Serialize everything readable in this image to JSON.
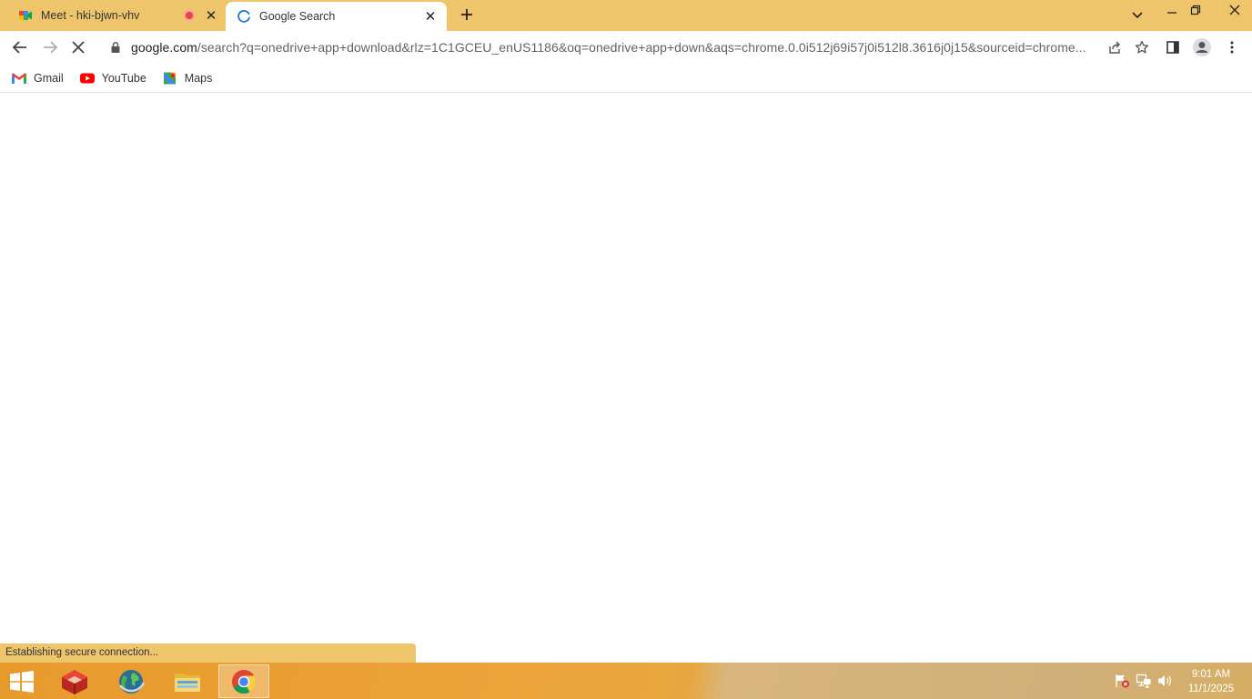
{
  "tabs": [
    {
      "title": "Meet - hki-bjwn-vhv",
      "favicon": "google-meet-icon",
      "recording": true,
      "active": false
    },
    {
      "title": "Google Search",
      "favicon": "loading-spinner-icon",
      "recording": false,
      "active": true
    }
  ],
  "toolbar": {
    "url_host": "google.com",
    "url_rest": "/search?q=onedrive+app+download&rlz=1C1GCEU_enUS1186&oq=onedrive+app+down&aqs=chrome.0.0i512j69i57j0i512l8.3616j0j15&sourceid=chrome..."
  },
  "bookmarks": [
    {
      "label": "Gmail",
      "icon": "gmail-icon"
    },
    {
      "label": "YouTube",
      "icon": "youtube-icon"
    },
    {
      "label": "Maps",
      "icon": "maps-icon"
    }
  ],
  "status": {
    "text": "Establishing secure connection..."
  },
  "taskbar": {
    "apps": [
      "app-icon",
      "globe-icon",
      "file-explorer-icon",
      "chrome-icon"
    ],
    "active_app": "chrome-icon",
    "clock_time": "9:01 AM",
    "clock_date": "11/1/2025"
  },
  "colors": {
    "titlebar": "#efc56b",
    "taskbar": "#e9a13a",
    "accent": "#1a73e8"
  }
}
